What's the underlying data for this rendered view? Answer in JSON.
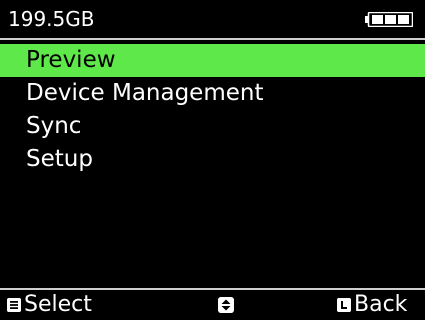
{
  "status": {
    "storage": "199.5GB",
    "battery_level": 1.0
  },
  "menu": {
    "items": [
      {
        "label": "Preview",
        "selected": true
      },
      {
        "label": "Device Management",
        "selected": false
      },
      {
        "label": "Sync",
        "selected": false
      },
      {
        "label": "Setup",
        "selected": false
      }
    ]
  },
  "footer": {
    "select_label": "Select",
    "back_label": "Back",
    "select_key_glyph": "menu-key-icon",
    "back_key_glyph": "l-key-icon",
    "nav_key_glyph": "up-down-nav-icon"
  },
  "colors": {
    "highlight": "#5ee84a",
    "background": "#000000",
    "text": "#ffffff"
  }
}
